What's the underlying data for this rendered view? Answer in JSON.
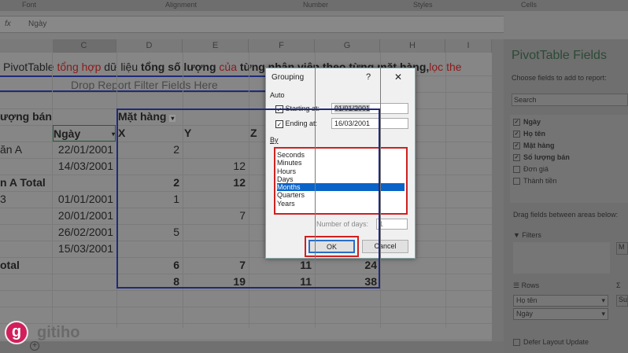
{
  "ribbon": {
    "groups": [
      "Font",
      "Alignment",
      "Number",
      "Styles",
      "Cells"
    ]
  },
  "formula_bar": {
    "fx": "fx",
    "value": "Ngày"
  },
  "columns": [
    "C",
    "D",
    "E",
    "F",
    "G",
    "H",
    "I"
  ],
  "sheet": {
    "title_parts": [
      {
        "t": "PivotTable ",
        "s": "n"
      },
      {
        "t": "tổng hợp",
        "s": "red"
      },
      {
        "t": " dữ liệu ",
        "s": "n"
      },
      {
        "t": "tổng số lượng",
        "s": "b"
      },
      {
        "t": " của",
        "s": "red"
      },
      {
        "t": " từng nhân viên theo từng mặt hàng,",
        "s": "b"
      },
      {
        "t": "lọc the",
        "s": "red"
      }
    ],
    "filter_drop": "Drop Report Filter Fields Here",
    "values_label": "ượng bán",
    "col_field": "Mặt hàng",
    "date_header": "Ngày",
    "col_items": [
      "X",
      "Y",
      "Z"
    ],
    "rows": [
      {
        "a": "ăn A",
        "c": "22/01/2001",
        "d": "2",
        "e": "",
        "f": "",
        "g": "",
        "bold": false
      },
      {
        "a": "",
        "c": "14/03/2001",
        "d": "",
        "e": "12",
        "f": "",
        "g": "",
        "bold": false
      },
      {
        "a": "n A Total",
        "c": "",
        "d": "2",
        "e": "12",
        "f": "",
        "g": "",
        "bold": true
      },
      {
        "a": "3",
        "c": "01/01/2001",
        "d": "1",
        "e": "",
        "f": "",
        "g": "",
        "bold": false
      },
      {
        "a": "",
        "c": "20/01/2001",
        "d": "",
        "e": "7",
        "f": "",
        "g": "",
        "bold": false
      },
      {
        "a": "",
        "c": "26/02/2001",
        "d": "5",
        "e": "",
        "f": "",
        "g": "",
        "bold": false
      },
      {
        "a": "",
        "c": "15/03/2001",
        "d": "",
        "e": "",
        "f": "",
        "g": "",
        "bold": false
      },
      {
        "a": "otal",
        "c": "",
        "d": "6",
        "e": "7",
        "f": "11",
        "g": "24",
        "bold": true
      },
      {
        "a": "",
        "c": "",
        "d": "8",
        "e": "19",
        "f": "11",
        "g": "38",
        "bold": true
      }
    ]
  },
  "panel": {
    "title": "PivotTable Fields",
    "subtitle": "Choose fields to add to report:",
    "search_placeholder": "Search",
    "fields": [
      {
        "label": "Ngày",
        "checked": true
      },
      {
        "label": "Họ tên",
        "checked": true
      },
      {
        "label": "Mặt hàng",
        "checked": true
      },
      {
        "label": "Số lượng bán",
        "checked": true
      },
      {
        "label": "Đơn giá",
        "checked": false
      },
      {
        "label": "Thành tiền",
        "checked": false
      }
    ],
    "drag_label": "Drag fields between areas below:",
    "filters": "Filters",
    "columns_item": "M",
    "rows": "Rows",
    "sigma": "Σ",
    "values_item": "Su",
    "row_items": [
      "Họ tên",
      "Ngày"
    ],
    "defer": "Defer Layout Update"
  },
  "dialog": {
    "title": "Grouping",
    "help": "?",
    "close": "✕",
    "auto": "Auto",
    "starting_label": "Starting at:",
    "starting_value": "01/01/2001",
    "ending_label": "Ending at:",
    "ending_value": "16/03/2001",
    "by": "By",
    "options": [
      "Seconds",
      "Minutes",
      "Hours",
      "Days",
      "Months",
      "Quarters",
      "Years"
    ],
    "selected": "Months",
    "days_label": "Number of days:",
    "days_value": "1",
    "ok": "OK",
    "cancel": "Cancel"
  },
  "watermark": "gitiho",
  "colors": {
    "highlight": "#0a64c8",
    "annotation": "#d02020",
    "pivot_border": "#1f2a7a"
  }
}
